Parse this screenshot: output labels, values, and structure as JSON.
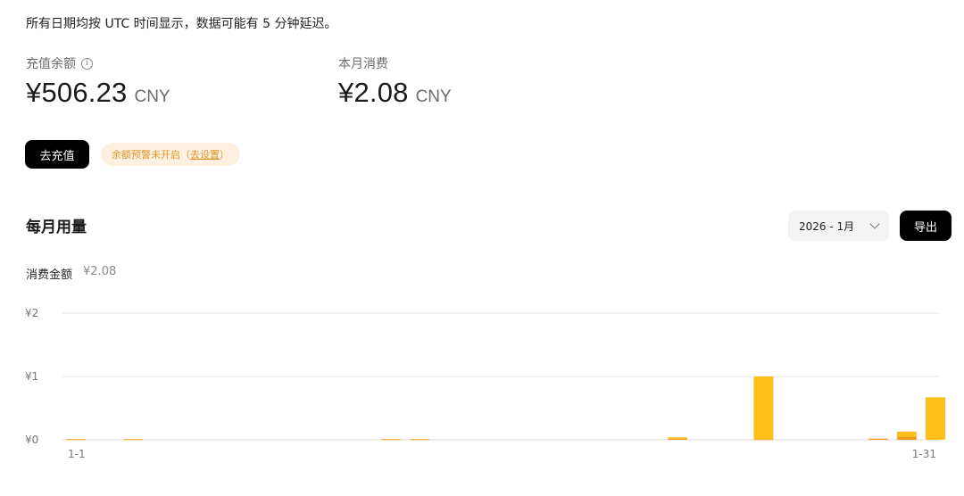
{
  "notice": "所有日期均按 UTC 时间显示，数据可能有 5 分钟延迟。",
  "balance": {
    "label": "充值余额",
    "amount": "¥506.23",
    "unit": "CNY",
    "info_icon": "info-circle-icon"
  },
  "monthly_spend": {
    "label": "本月消费",
    "amount": "¥2.08",
    "unit": "CNY"
  },
  "actions": {
    "recharge_label": "去充值",
    "alert_text": "余额预警未开启（",
    "alert_link": "去设置",
    "alert_close": "）"
  },
  "usage": {
    "title": "每月用量",
    "month_select": "2026 - 1月",
    "export_label": "导出",
    "spend_label": "消费金额",
    "spend_value": "¥2.08"
  },
  "colors": {
    "series_light": "#ffbf1a",
    "series_dark": "#f59b1c",
    "gridline": "#e6e6e6"
  },
  "chart_data": {
    "type": "bar",
    "stacked": true,
    "x_tick_labels": [
      "1-1",
      "1-31"
    ],
    "y_tick_labels": [
      "¥0",
      "¥1",
      "¥2"
    ],
    "ylim": [
      0,
      2
    ],
    "grid": true,
    "categories": [
      1,
      2,
      3,
      4,
      5,
      6,
      7,
      8,
      9,
      10,
      11,
      12,
      13,
      14,
      15,
      16,
      17,
      18,
      19,
      20,
      21,
      22,
      23,
      24,
      25,
      26,
      27,
      28,
      29,
      30,
      31
    ],
    "series": [
      {
        "values": [
          0.01,
          0,
          0.01,
          0,
          0,
          0,
          0,
          0,
          0,
          0,
          0,
          0.01,
          0.01,
          0,
          0,
          0,
          0,
          0,
          0,
          0,
          0,
          0.02,
          0,
          0,
          0.01,
          0,
          0,
          0,
          0.02,
          0.05,
          0.0
        ]
      },
      {
        "values": [
          0.01,
          0,
          0.01,
          0,
          0,
          0,
          0,
          0,
          0,
          0,
          0,
          0.01,
          0.01,
          0,
          0,
          0,
          0,
          0,
          0,
          0,
          0,
          0.04,
          0,
          0,
          1.0,
          0,
          0,
          0,
          0.02,
          0.13,
          0.67
        ]
      }
    ]
  }
}
